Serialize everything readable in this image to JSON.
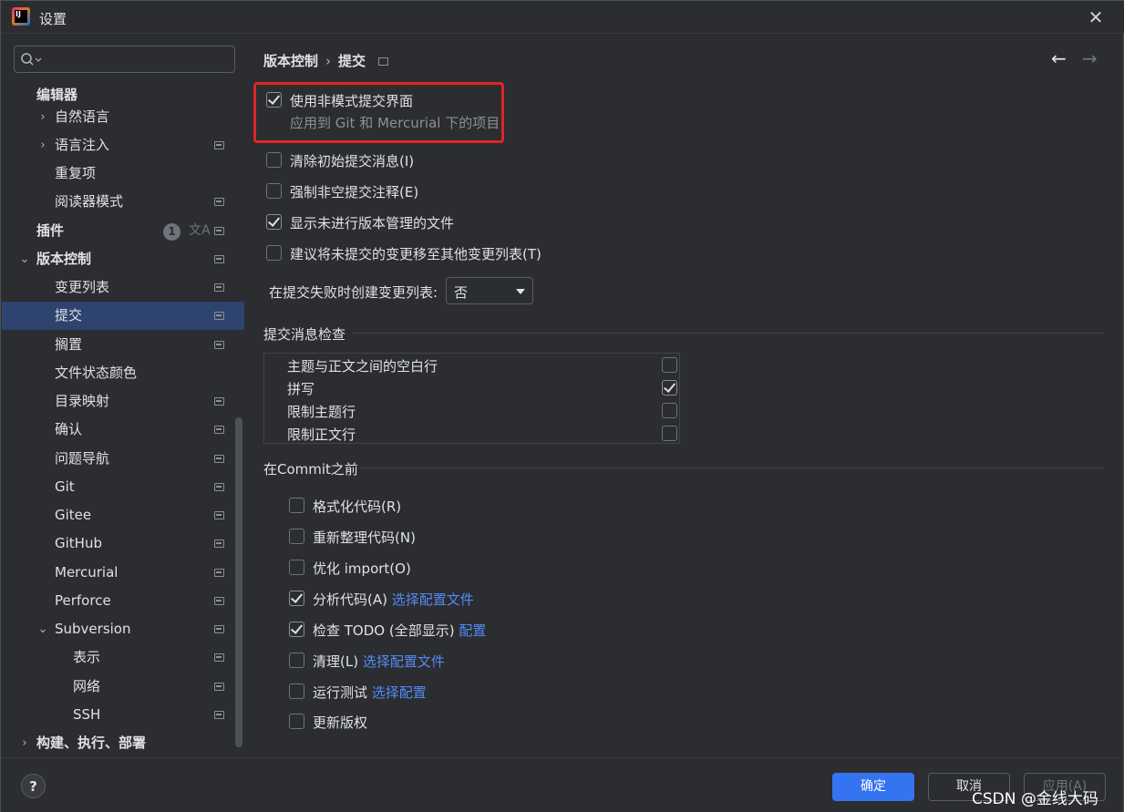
{
  "window": {
    "title": "设置"
  },
  "sidebar": {
    "search_placeholder": "",
    "items": [
      {
        "label": "编辑器"
      },
      {
        "label": "自然语言"
      },
      {
        "label": "语言注入"
      },
      {
        "label": "重复项"
      },
      {
        "label": "阅读器模式"
      },
      {
        "label": "插件",
        "badge": "1"
      },
      {
        "label": "版本控制"
      },
      {
        "label": "变更列表"
      },
      {
        "label": "提交"
      },
      {
        "label": "搁置"
      },
      {
        "label": "文件状态颜色"
      },
      {
        "label": "目录映射"
      },
      {
        "label": "确认"
      },
      {
        "label": "问题导航"
      },
      {
        "label": "Git"
      },
      {
        "label": "Gitee"
      },
      {
        "label": "GitHub"
      },
      {
        "label": "Mercurial"
      },
      {
        "label": "Perforce"
      },
      {
        "label": "Subversion"
      },
      {
        "label": "表示"
      },
      {
        "label": "网络"
      },
      {
        "label": "SSH"
      },
      {
        "label": "构建、执行、部署"
      }
    ]
  },
  "breadcrumb": {
    "parent": "版本控制",
    "current": "提交"
  },
  "options": {
    "non_modal": {
      "label": "使用非模式提交界面",
      "sub": "应用到 Git 和 Mercurial 下的项目",
      "checked": true
    },
    "clear_initial": {
      "label": "清除初始提交消息(I)",
      "checked": false
    },
    "force_nonempty": {
      "label": "强制非空提交注释(E)",
      "checked": false
    },
    "show_unversioned": {
      "label": "显示未进行版本管理的文件",
      "checked": true
    },
    "suggest_move": {
      "label": "建议将未提交的变更移至其他变更列表(T)",
      "checked": false
    },
    "create_changelist_label": "在提交失败时创建变更列表:",
    "create_changelist_value": "否"
  },
  "checks_section": {
    "title": "提交消息检查",
    "rows": [
      {
        "label": "主题与正文之间的空白行",
        "checked": false
      },
      {
        "label": "拼写",
        "checked": true
      },
      {
        "label": "限制主题行",
        "checked": false
      },
      {
        "label": "限制正文行",
        "checked": false
      }
    ]
  },
  "before_commit": {
    "title": "在Commit之前",
    "items": [
      {
        "label": "格式化代码(R)",
        "link": "",
        "checked": false
      },
      {
        "label": "重新整理代码(N)",
        "link": "",
        "checked": false
      },
      {
        "label": "优化 import(O)",
        "link": "",
        "checked": false
      },
      {
        "label": "分析代码(A)",
        "link": "选择配置文件",
        "checked": true
      },
      {
        "label": "检查 TODO (全部显示)",
        "link": "配置",
        "checked": true
      },
      {
        "label": "清理(L)",
        "link": "选择配置文件",
        "checked": false
      },
      {
        "label": "运行测试",
        "link": "选择配置",
        "checked": false
      },
      {
        "label": "更新版权",
        "link": "",
        "checked": false
      }
    ]
  },
  "footer": {
    "help": "?",
    "ok": "确定",
    "cancel": "取消",
    "apply": "应用(A)",
    "watermark": "CSDN @金线大码"
  },
  "colors": {
    "accent": "#3574f0",
    "link": "#548af7",
    "highlight": "#e0242a",
    "selected": "#2e436e"
  }
}
